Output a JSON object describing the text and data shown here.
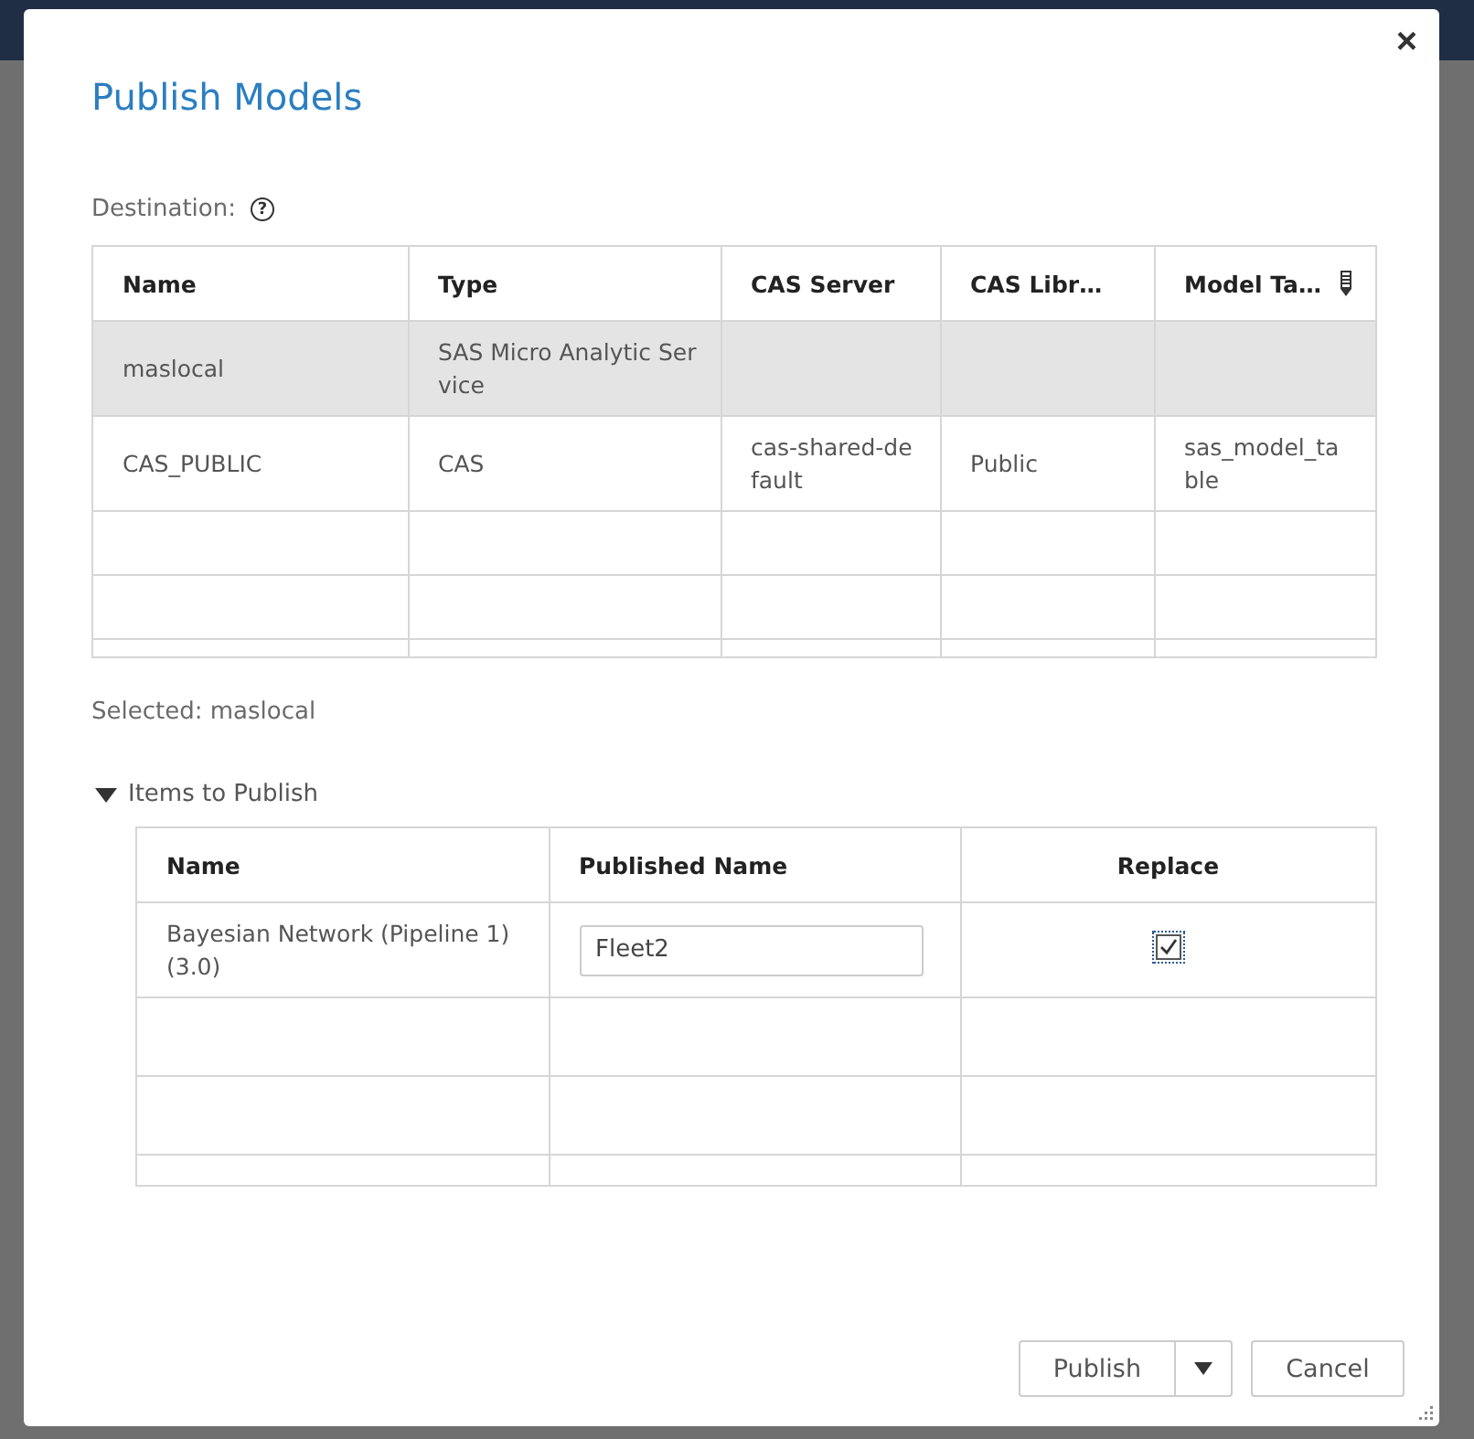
{
  "dialog": {
    "title": "Publish Models",
    "close": "×",
    "destination": {
      "label": "Destination:",
      "help": "?",
      "columns": [
        {
          "label": "Name"
        },
        {
          "label": "Type"
        },
        {
          "label": "CAS Server"
        },
        {
          "label": "CAS Libr…"
        },
        {
          "label": "Model Ta…"
        }
      ],
      "rows": [
        {
          "selected": true,
          "cells": [
            "maslocal",
            "SAS Micro Analytic Service",
            "",
            "",
            ""
          ]
        },
        {
          "selected": false,
          "cells": [
            "CAS_PUBLIC",
            "CAS",
            "cas-shared-default",
            "Public",
            "sas_model_table"
          ]
        }
      ]
    },
    "selected_text": "Selected: maslocal",
    "items": {
      "label": "Items to Publish",
      "expanded": true,
      "columns": [
        "Name",
        "Published Name",
        "Replace"
      ],
      "rows": [
        {
          "name": "Bayesian Network (Pipeline 1) (3.0)",
          "published_name": "Fleet2",
          "replace": true
        }
      ]
    },
    "buttons": {
      "publish": "Publish",
      "cancel": "Cancel"
    }
  }
}
